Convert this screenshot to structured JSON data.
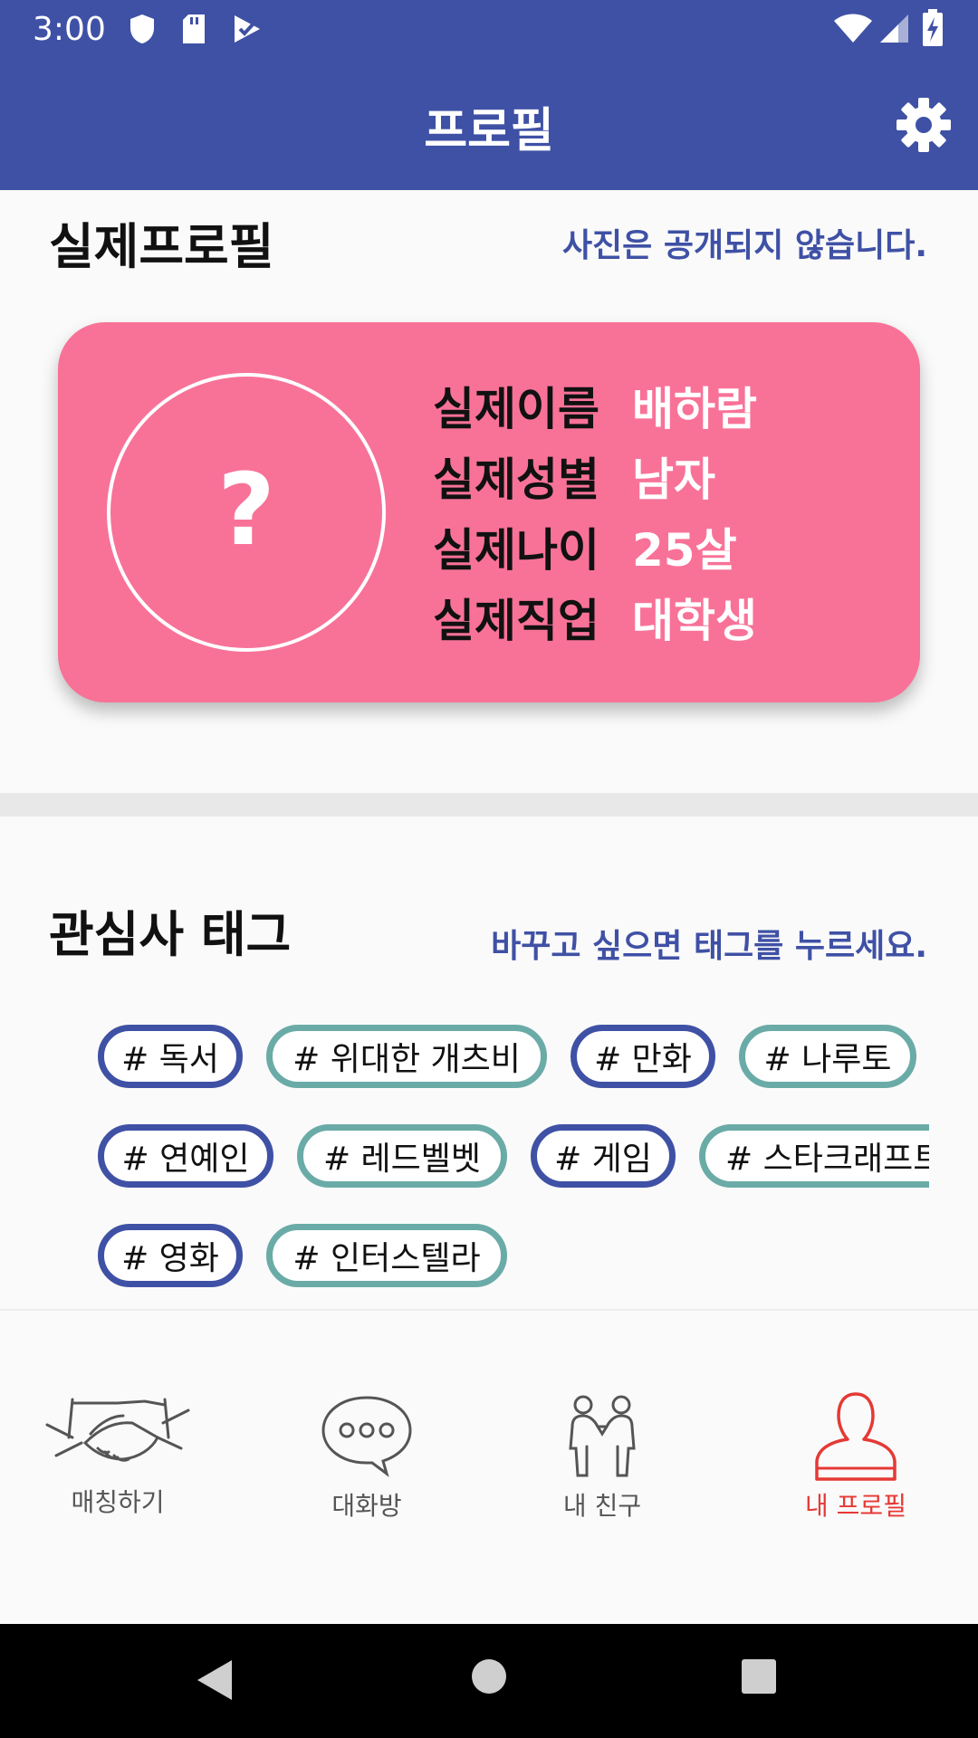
{
  "status_bar": {
    "time": "3:00"
  },
  "app_bar": {
    "title": "프로필"
  },
  "real_profile": {
    "title": "실제프로필",
    "hint": "사진은 공개되지 않습니다.",
    "avatar_placeholder": "?",
    "rows": [
      {
        "label": "실제이름",
        "value": "배하람"
      },
      {
        "label": "실제성별",
        "value": "남자"
      },
      {
        "label": "실제나이",
        "value": "25살"
      },
      {
        "label": "실제직업",
        "value": "대학생"
      }
    ],
    "card_color": "#f87298"
  },
  "interests": {
    "title": "관심사 태그",
    "hint": "바꾸고 싶으면 태그를 누르세요.",
    "tags": [
      "# 독서",
      "# 위대한 개츠비",
      "# 만화",
      "# 나루토",
      "# 연예인",
      "# 레드벨벳",
      "# 게임",
      "# 스타크래프트",
      "# 영화",
      "# 인터스텔라"
    ]
  },
  "bottom_nav": {
    "items": [
      {
        "label": "매칭하기",
        "icon": "handshake-icon"
      },
      {
        "label": "대화방",
        "icon": "chat-bubble-icon"
      },
      {
        "label": "내 친구",
        "icon": "friends-icon"
      },
      {
        "label": "내 프로필",
        "icon": "person-icon",
        "active": true
      }
    ]
  },
  "colors": {
    "primary": "#3f51a5",
    "tag_blue": "#3f51a5",
    "tag_teal": "#6aaba7",
    "active_nav": "#e53935"
  }
}
